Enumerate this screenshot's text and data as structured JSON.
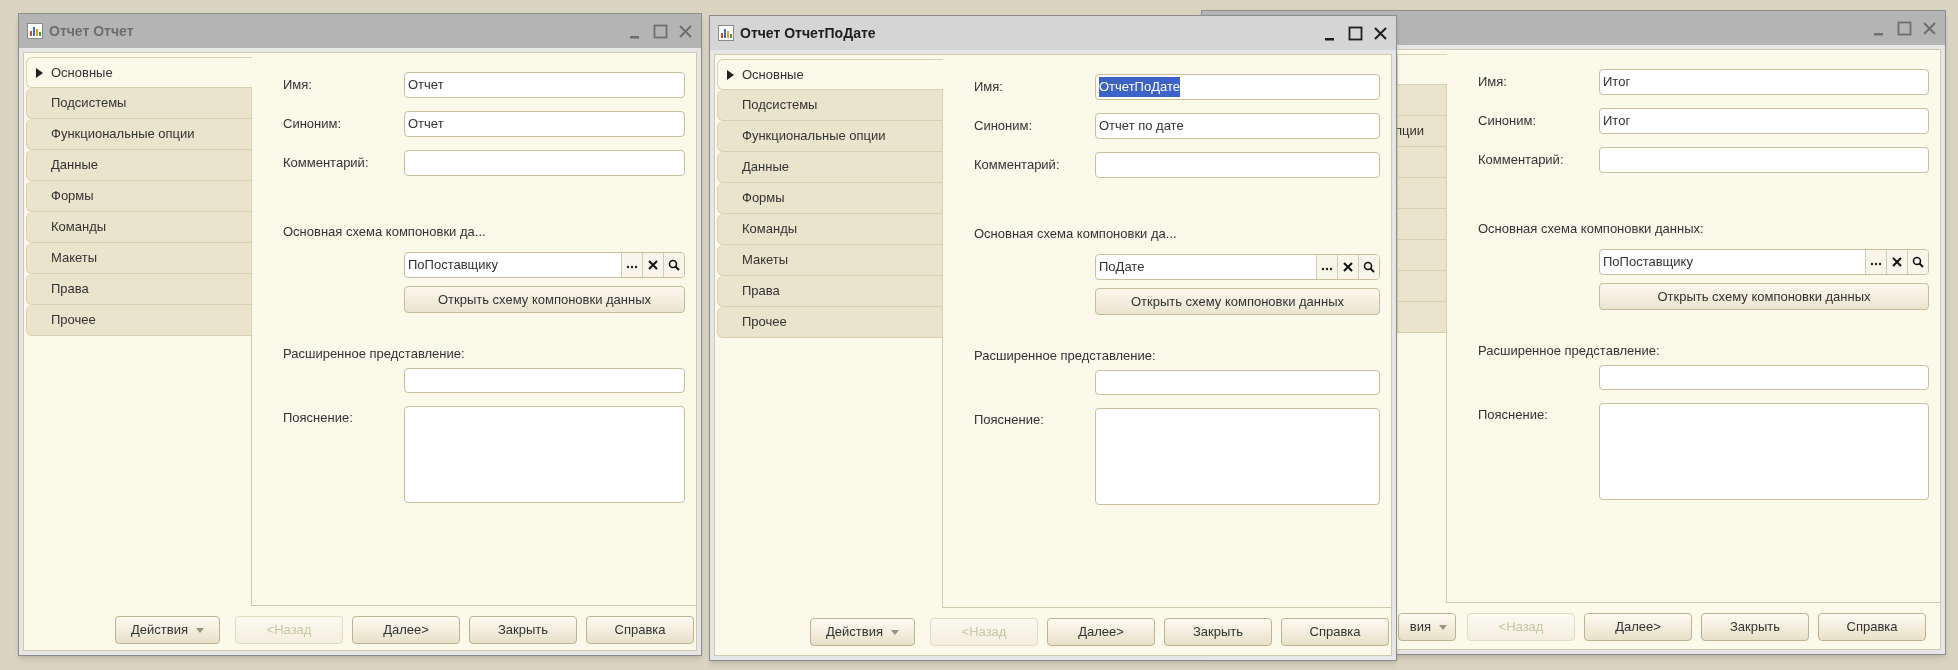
{
  "windows": [
    {
      "title": "Отчет Отчет",
      "active": false,
      "sidebar": [
        {
          "label": "Основные",
          "selected": true
        },
        {
          "label": "Подсистемы",
          "selected": false
        },
        {
          "label": "Функциональные опции",
          "selected": false
        },
        {
          "label": "Данные",
          "selected": false
        },
        {
          "label": "Формы",
          "selected": false
        },
        {
          "label": "Команды",
          "selected": false
        },
        {
          "label": "Макеты",
          "selected": false
        },
        {
          "label": "Права",
          "selected": false
        },
        {
          "label": "Прочее",
          "selected": false
        }
      ],
      "name": {
        "label": "Имя:",
        "value": "Отчет",
        "highlighted": false
      },
      "synonym": {
        "label": "Синоним:",
        "value": "Отчет"
      },
      "comment": {
        "label": "Комментарий:"
      },
      "schema": {
        "label": "Основная схема компоновки да...",
        "value": "ПоПоставщику",
        "open_button": "Открыть схему компоновки данных"
      },
      "extended_presentation": {
        "label": "Расширенное представление:"
      },
      "explanation": {
        "label": "Пояснение:"
      },
      "buttons": [
        {
          "label": "Действия",
          "kind": "menu",
          "disabled": false
        },
        {
          "label": "<Назад",
          "kind": "plain",
          "disabled": true
        },
        {
          "label": "Далее>",
          "kind": "plain",
          "disabled": false
        },
        {
          "label": "Закрыть",
          "kind": "plain",
          "disabled": false
        },
        {
          "label": "Справка",
          "kind": "plain",
          "disabled": false
        }
      ]
    },
    {
      "title": "Отчет ОтчетПоДате",
      "active": true,
      "sidebar": [
        {
          "label": "Основные",
          "selected": true
        },
        {
          "label": "Подсистемы",
          "selected": false
        },
        {
          "label": "Функциональные опции",
          "selected": false
        },
        {
          "label": "Данные",
          "selected": false
        },
        {
          "label": "Формы",
          "selected": false
        },
        {
          "label": "Команды",
          "selected": false
        },
        {
          "label": "Макеты",
          "selected": false
        },
        {
          "label": "Права",
          "selected": false
        },
        {
          "label": "Прочее",
          "selected": false
        }
      ],
      "name": {
        "label": "Имя:",
        "value": "ОтчетПоДате",
        "highlighted": true
      },
      "synonym": {
        "label": "Синоним:",
        "value": "Отчет по дате"
      },
      "comment": {
        "label": "Комментарий:"
      },
      "schema": {
        "label": "Основная схема компоновки да...",
        "value": "ПоДате",
        "open_button": "Открыть схему компоновки данных"
      },
      "extended_presentation": {
        "label": "Расширенное представление:"
      },
      "explanation": {
        "label": "Пояснение:"
      },
      "buttons": [
        {
          "label": "Действия",
          "kind": "menu",
          "disabled": false
        },
        {
          "label": "<Назад",
          "kind": "plain",
          "disabled": true
        },
        {
          "label": "Далее>",
          "kind": "plain",
          "disabled": false
        },
        {
          "label": "Закрыть",
          "kind": "plain",
          "disabled": false
        },
        {
          "label": "Справка",
          "kind": "plain",
          "disabled": false
        }
      ]
    },
    {
      "active": false,
      "sidebar": [
        {
          "selected": true
        },
        {
          "selected": false
        },
        {
          "label": "пции",
          "selected": false
        },
        {
          "selected": false
        },
        {
          "selected": false
        },
        {
          "selected": false
        },
        {
          "selected": false
        },
        {
          "selected": false
        },
        {
          "selected": false
        }
      ],
      "name": {
        "label": "Имя:",
        "value": "Итог",
        "highlighted": false
      },
      "synonym": {
        "label": "Синоним:",
        "value": "Итог"
      },
      "comment": {
        "label": "Комментарий:"
      },
      "schema": {
        "label": "Основная схема компоновки данных:",
        "value": "ПоПоставщику",
        "open_button": "Открыть схему компоновки данных"
      },
      "extended_presentation": {
        "label": "Расширенное представление:"
      },
      "explanation": {
        "label": "Пояснение:"
      },
      "buttons": [
        {
          "label": "вия",
          "kind": "menu",
          "disabled": false
        },
        {
          "label": "<Назад",
          "kind": "plain",
          "disabled": true
        },
        {
          "label": "Далее>",
          "kind": "plain",
          "disabled": false
        },
        {
          "label": "Закрыть",
          "kind": "plain",
          "disabled": false
        },
        {
          "label": "Справка",
          "kind": "plain",
          "disabled": false
        }
      ]
    }
  ]
}
